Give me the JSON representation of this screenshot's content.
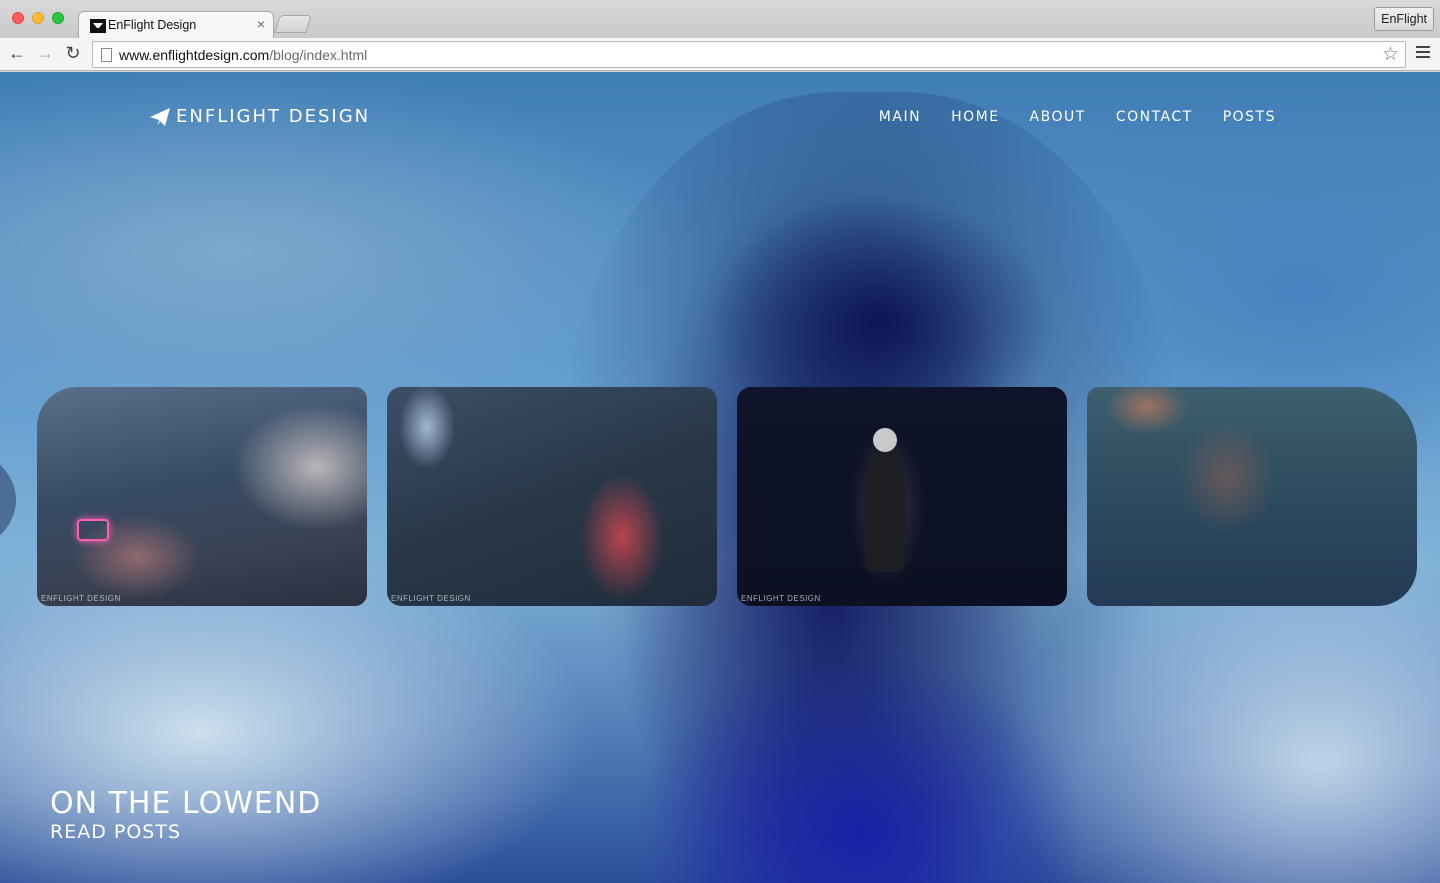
{
  "browser": {
    "tab_title": "EnFlight Design",
    "tab_close": "×",
    "profile_label": "EnFlight",
    "url_host": "www.enflightdesign.com",
    "url_path": "/blog/index.html"
  },
  "site": {
    "brand": "ENFLIGHT DESIGN",
    "nav": [
      "MAIN",
      "HOME",
      "ABOUT",
      "CONTACT",
      "POSTS"
    ]
  },
  "carousel": {
    "cards": [
      {
        "watermark": "ENFLIGHT DESIGN"
      },
      {
        "watermark": "ENFLIGHT DESIGN"
      },
      {
        "watermark": "ENFLIGHT DESIGN"
      },
      {
        "watermark": ""
      }
    ]
  },
  "hero": {
    "title": "ON THE LOWEND",
    "link": "READ POSTS"
  }
}
